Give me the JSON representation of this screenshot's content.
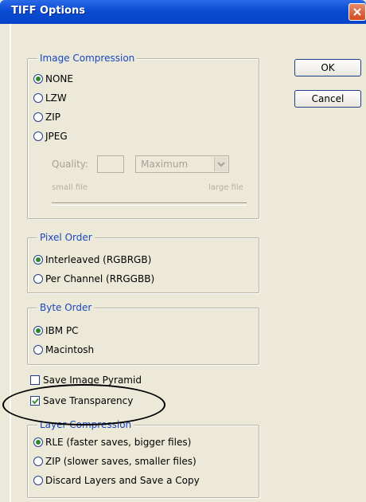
{
  "window": {
    "title": "TIFF Options"
  },
  "buttons": {
    "ok": "OK",
    "cancel": "Cancel"
  },
  "image_compression": {
    "legend": "Image Compression",
    "options": [
      "NONE",
      "LZW",
      "ZIP",
      "JPEG"
    ],
    "selected": "NONE",
    "quality_label": "Quality:",
    "quality_value": "",
    "quality_select": "Maximum",
    "small_file": "small file",
    "large_file": "large file"
  },
  "pixel_order": {
    "legend": "Pixel Order",
    "options": [
      "Interleaved (RGBRGB)",
      "Per Channel (RRGGBB)"
    ],
    "selected": "Interleaved (RGBRGB)"
  },
  "byte_order": {
    "legend": "Byte Order",
    "options": [
      "IBM PC",
      "Macintosh"
    ],
    "selected": "IBM PC"
  },
  "save_image_pyramid": {
    "label": "Save Image Pyramid",
    "checked": false
  },
  "save_transparency": {
    "label": "Save Transparency",
    "checked": true
  },
  "layer_compression": {
    "legend": "Layer Compression",
    "options": [
      "RLE (faster saves, bigger files)",
      "ZIP (slower saves, smaller files)",
      "Discard Layers and Save a Copy"
    ],
    "selected": "RLE (faster saves, bigger files)"
  },
  "colors": {
    "title_bar": "#0a4cd2",
    "legend_text": "#1a46c0",
    "dialog_bg": "#ece9d8",
    "close_button": "#d24a1e"
  },
  "icons": {
    "close": "close-icon",
    "checkmark": "checkmark-icon",
    "dropdown": "chevron-down-icon"
  }
}
